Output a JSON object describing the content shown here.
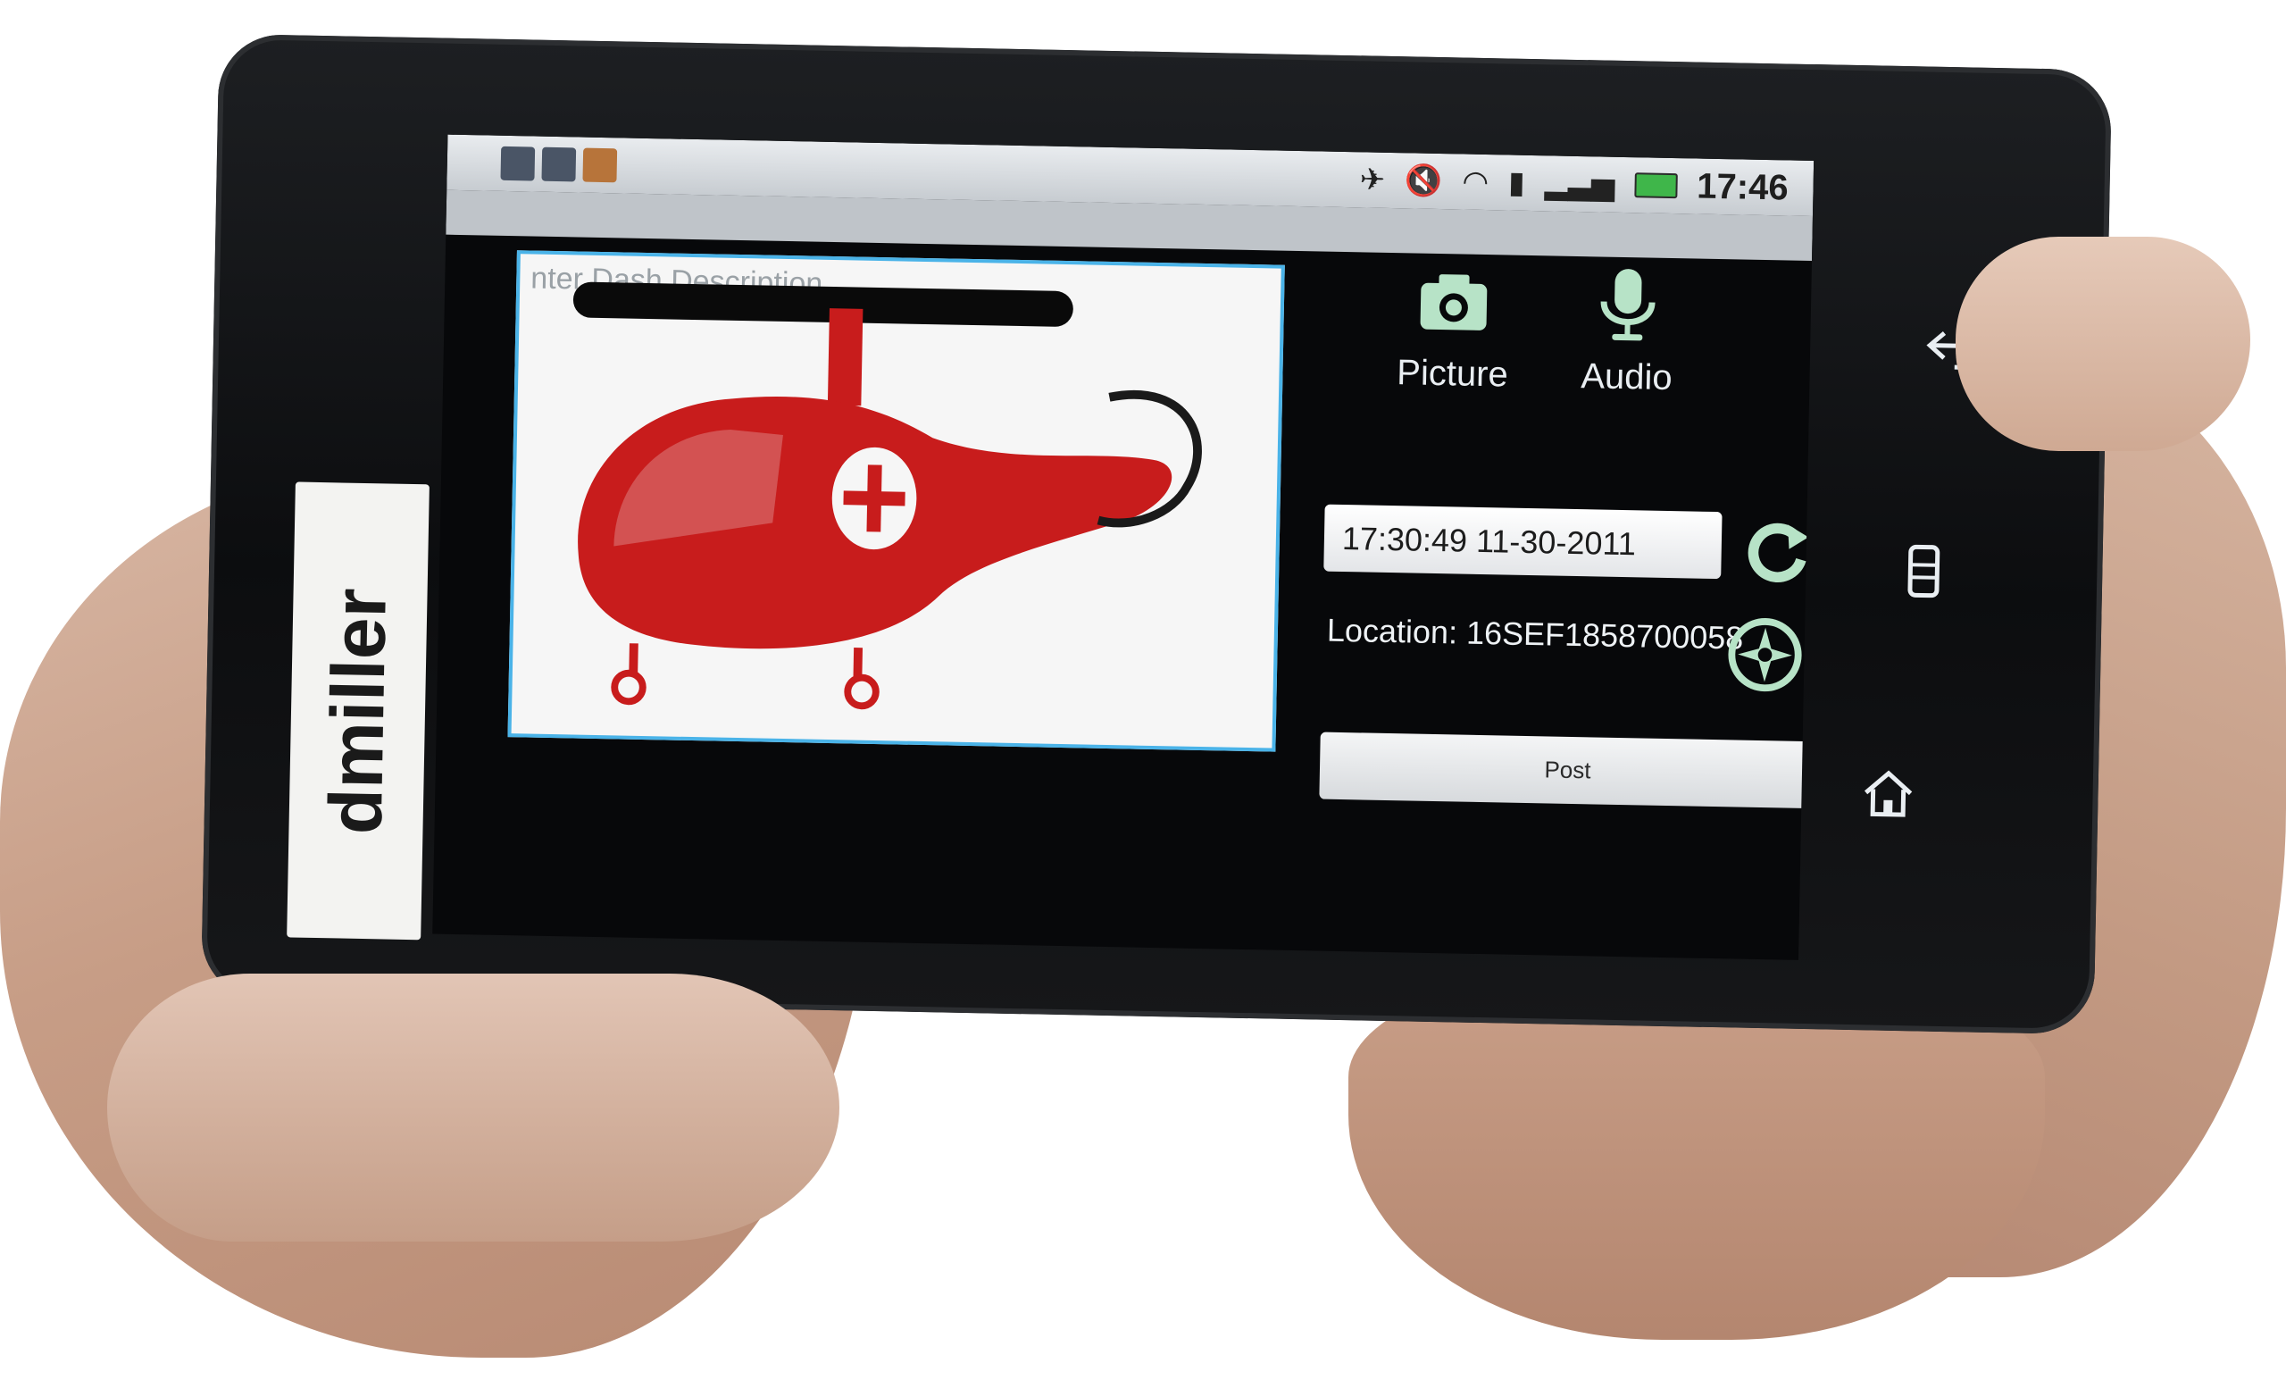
{
  "status_bar": {
    "time": "17:46"
  },
  "description": {
    "placeholder": "nter Dash Description"
  },
  "label": {
    "name": "dmiller"
  },
  "actions": {
    "picture_label": "Picture",
    "audio_label": "Audio"
  },
  "timestamp": {
    "value": "17:30:49 11-30-2011"
  },
  "location": {
    "text": "Location: 16SEF1858700058"
  },
  "post": {
    "label": "Post"
  },
  "colors": {
    "accent": "#4ab3e8",
    "helicopter": "#c81c1c",
    "icon_green": "#b7e3c7"
  },
  "icons": [
    "camera-icon",
    "microphone-icon",
    "refresh-icon",
    "compass-icon",
    "back-icon",
    "menu-icon",
    "home-icon"
  ]
}
